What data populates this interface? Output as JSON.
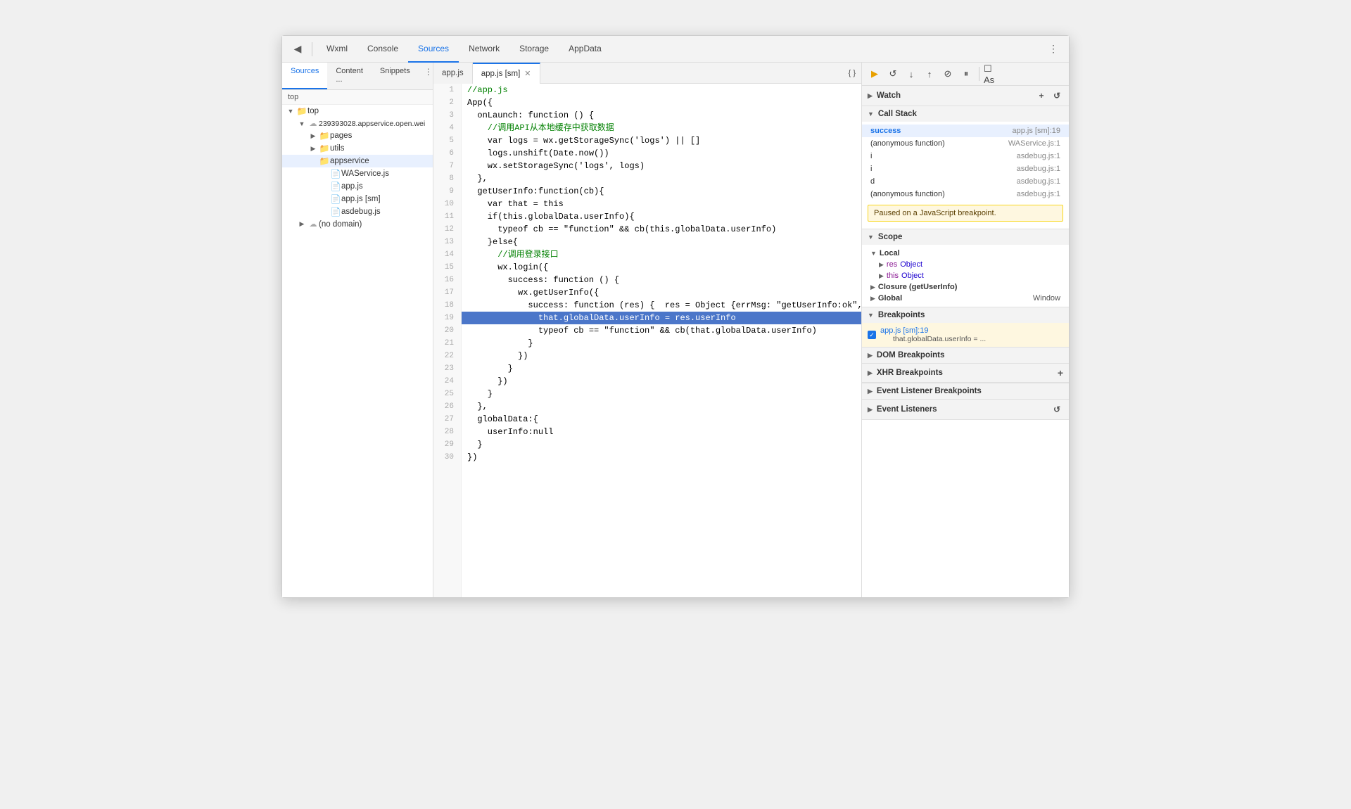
{
  "toolbar": {
    "back_icon": "◀",
    "nav_tabs": [
      {
        "id": "wxml",
        "label": "Wxml",
        "active": false
      },
      {
        "id": "console",
        "label": "Console",
        "active": false
      },
      {
        "id": "sources",
        "label": "Sources",
        "active": true
      },
      {
        "id": "network",
        "label": "Network",
        "active": false
      },
      {
        "id": "storage",
        "label": "Storage",
        "active": false
      },
      {
        "id": "appdata",
        "label": "AppData",
        "active": false
      }
    ],
    "more_icon": "⋮"
  },
  "sidebar": {
    "tabs": [
      {
        "id": "sources",
        "label": "Sources",
        "active": true
      },
      {
        "id": "content",
        "label": "Content ...",
        "active": false
      },
      {
        "id": "snippets",
        "label": "Snippets",
        "active": false
      }
    ],
    "top_frame": "top",
    "file_tree": [
      {
        "indent": 1,
        "type": "folder",
        "label": "top",
        "expanded": true,
        "arrow": "▼"
      },
      {
        "indent": 2,
        "type": "cloud",
        "label": "239393028.appservice.open.wei",
        "expanded": true,
        "arrow": "▼"
      },
      {
        "indent": 3,
        "type": "folder",
        "label": "pages",
        "expanded": false,
        "arrow": "▶"
      },
      {
        "indent": 3,
        "type": "folder",
        "label": "utils",
        "expanded": false,
        "arrow": "▶"
      },
      {
        "indent": 3,
        "type": "folder",
        "label": "appservice",
        "expanded": false,
        "selected": true
      },
      {
        "indent": 4,
        "type": "file",
        "label": "WAService.js"
      },
      {
        "indent": 4,
        "type": "file",
        "label": "app.js"
      },
      {
        "indent": 4,
        "type": "file",
        "label": "app.js [sm]"
      },
      {
        "indent": 4,
        "type": "file",
        "label": "asdebug.js"
      },
      {
        "indent": 2,
        "type": "cloud",
        "label": "(no domain)",
        "expanded": false,
        "arrow": "▶"
      }
    ]
  },
  "editor": {
    "tabs": [
      {
        "label": "app.js",
        "active": false,
        "closeable": false
      },
      {
        "label": "app.js [sm]",
        "active": true,
        "closeable": true
      }
    ],
    "active_line": 19,
    "lines": [
      {
        "num": 1,
        "code": "//app.js"
      },
      {
        "num": 2,
        "code": "App({"
      },
      {
        "num": 3,
        "code": "  onLaunch: function () {"
      },
      {
        "num": 4,
        "code": "    //调用API从本地缓存中获取数据",
        "type": "comment"
      },
      {
        "num": 5,
        "code": "    var logs = wx.getStorageSync('logs') || []"
      },
      {
        "num": 6,
        "code": "    logs.unshift(Date.now())"
      },
      {
        "num": 7,
        "code": "    wx.setStorageSync('logs', logs)"
      },
      {
        "num": 8,
        "code": "  },"
      },
      {
        "num": 9,
        "code": "  getUserInfo:function(cb){"
      },
      {
        "num": 10,
        "code": "    var that = this"
      },
      {
        "num": 11,
        "code": "    if(this.globalData.userInfo){"
      },
      {
        "num": 12,
        "code": "      typeof cb == \"function\" && cb(this.globalData.userInfo)"
      },
      {
        "num": 13,
        "code": "    }else{"
      },
      {
        "num": 14,
        "code": "      //调用登录接口",
        "type": "comment"
      },
      {
        "num": 15,
        "code": "      wx.login({"
      },
      {
        "num": 16,
        "code": "        success: function () {"
      },
      {
        "num": 17,
        "code": "          wx.getUserInfo({"
      },
      {
        "num": 18,
        "code": "            success: function (res) {  res = Object {errMsg: \"getUserInfo:ok\", rawData: \"{\\\"nick"
      },
      {
        "num": 19,
        "code": "              that.globalData.userInfo = res.userInfo",
        "highlighted": true
      },
      {
        "num": 20,
        "code": "              typeof cb == \"function\" && cb(that.globalData.userInfo)"
      },
      {
        "num": 21,
        "code": "            }"
      },
      {
        "num": 22,
        "code": "          })"
      },
      {
        "num": 23,
        "code": "        }"
      },
      {
        "num": 24,
        "code": "      })"
      },
      {
        "num": 25,
        "code": "    }"
      },
      {
        "num": 26,
        "code": "  },"
      },
      {
        "num": 27,
        "code": "  globalData:{"
      },
      {
        "num": 28,
        "code": "    userInfo:null"
      },
      {
        "num": 29,
        "code": "  }"
      },
      {
        "num": 30,
        "code": "})"
      }
    ]
  },
  "right_panel": {
    "debugger_buttons": [
      {
        "icon": "▶",
        "title": "Resume",
        "active": false
      },
      {
        "icon": "↺",
        "title": "Step over",
        "active": false
      },
      {
        "icon": "↓",
        "title": "Step into",
        "active": false
      },
      {
        "icon": "↑",
        "title": "Step out",
        "active": false
      },
      {
        "icon": "⊘",
        "title": "Deactivate breakpoints",
        "active": false
      },
      {
        "icon": "⏸",
        "title": "Pause on exceptions",
        "active": false
      },
      {
        "icon": "☐",
        "title": "As"
      },
      {
        "icon": "⋮",
        "title": "More"
      }
    ],
    "watch": {
      "label": "Watch",
      "expanded": false
    },
    "call_stack": {
      "label": "Call Stack",
      "expanded": true,
      "items": [
        {
          "name": "success",
          "file": "app.js [sm]:19",
          "active": true,
          "color": "success"
        },
        {
          "name": "(anonymous function)",
          "file": "WAService.js:1"
        },
        {
          "name": "i",
          "file": "asdebug.js:1"
        },
        {
          "name": "i",
          "file": "asdebug.js:1"
        },
        {
          "name": "d",
          "file": "asdebug.js:1"
        },
        {
          "name": "(anonymous function)",
          "file": "asdebug.js:1"
        }
      ]
    },
    "paused_message": "Paused on a JavaScript breakpoint.",
    "scope": {
      "label": "Scope",
      "expanded": true,
      "local": {
        "label": "Local",
        "expanded": true,
        "items": [
          {
            "key": "res",
            "value": "Object",
            "expandable": true
          },
          {
            "key": "this",
            "value": "Object",
            "expandable": true
          }
        ]
      },
      "closure": {
        "label": "Closure (getUserInfo)",
        "expanded": false
      },
      "global": {
        "label": "Global",
        "value": "Window",
        "expanded": false
      }
    },
    "breakpoints": {
      "label": "Breakpoints",
      "expanded": true,
      "items": [
        {
          "file": "app.js [sm]:19",
          "code": "that.globalData.userInfo = ..."
        }
      ]
    },
    "dom_breakpoints": {
      "label": "DOM Breakpoints",
      "expanded": false
    },
    "xhr_breakpoints": {
      "label": "XHR Breakpoints",
      "expanded": false
    },
    "event_listener_breakpoints": {
      "label": "Event Listener Breakpoints",
      "expanded": false
    },
    "event_listeners": {
      "label": "Event Listeners",
      "expanded": false
    }
  }
}
